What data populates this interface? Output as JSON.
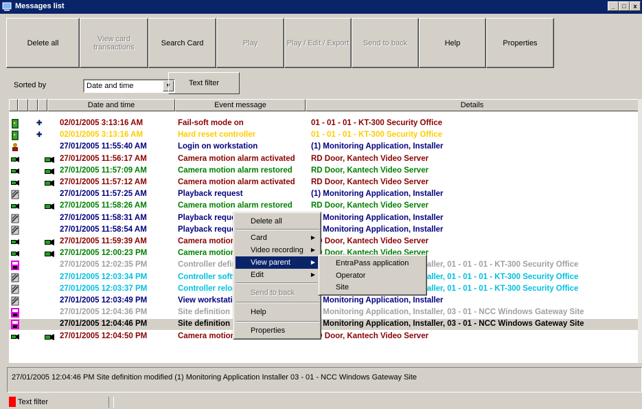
{
  "window": {
    "title": "Messages list",
    "min": "_",
    "max": "□",
    "close": "x"
  },
  "toolbar": {
    "buttons": [
      {
        "label": "Delete all",
        "enabled": true
      },
      {
        "label": "View card transactions",
        "enabled": false
      },
      {
        "label": "Search Card",
        "enabled": true
      },
      {
        "label": "Play",
        "enabled": false
      },
      {
        "label": "Play / Edit / Export",
        "enabled": false
      },
      {
        "label": "Send to back",
        "enabled": false
      },
      {
        "label": "Help",
        "enabled": true
      },
      {
        "label": "Properties",
        "enabled": true
      }
    ]
  },
  "sort": {
    "label": "Sorted by",
    "value": "Date and time",
    "text_filter": "Text filter"
  },
  "columns": {
    "date": "Date and time",
    "event": "Event message",
    "details": "Details"
  },
  "rows": [
    {
      "icon": "door-icon",
      "mark": "+",
      "color": "#8b0000",
      "date": "02/01/2005 3:13:16 AM",
      "event": "Fail-soft mode on",
      "details": "01 - 01 - 01 - KT-300 Security Office"
    },
    {
      "icon": "door-icon",
      "mark": "+",
      "color": "#ffcc00",
      "date": "02/01/2005 3:13:16 AM",
      "event": "Hard reset controller",
      "details": "01 - 01 - 01 - KT-300 Security Office"
    },
    {
      "icon": "user-icon",
      "mark": "",
      "color": "#000080",
      "date": "27/01/2005 11:55:40 AM",
      "event": "Login on workstation",
      "details": "(1) Monitoring Application, Installer"
    },
    {
      "icon": "camera-icon",
      "mark": "cam",
      "color": "#8b0000",
      "date": "27/01/2005 11:56:17 AM",
      "event": "Camera motion alarm activated",
      "details": "RD Door, Kantech Video Server"
    },
    {
      "icon": "camera-icon",
      "mark": "cam",
      "color": "#008000",
      "date": "27/01/2005 11:57:09 AM",
      "event": "Camera motion alarm restored",
      "details": "RD Door, Kantech Video Server"
    },
    {
      "icon": "camera-icon",
      "mark": "cam",
      "color": "#8b0000",
      "date": "27/01/2005 11:57:12 AM",
      "event": "Camera motion alarm activated",
      "details": "RD Door, Kantech Video Server"
    },
    {
      "icon": "playback-icon",
      "mark": "",
      "color": "#000080",
      "date": "27/01/2005 11:57:25 AM",
      "event": "Playback request",
      "details": "(1) Monitoring Application, Installer"
    },
    {
      "icon": "camera-icon",
      "mark": "cam",
      "color": "#008000",
      "date": "27/01/2005 11:58:26 AM",
      "event": "Camera motion alarm restored",
      "details": "RD Door, Kantech Video Server"
    },
    {
      "icon": "playback-icon",
      "mark": "",
      "color": "#000080",
      "date": "27/01/2005 11:58:31 AM",
      "event": "Playback request",
      "details": "(1) Monitoring Application, Installer"
    },
    {
      "icon": "playback-icon",
      "mark": "",
      "color": "#000080",
      "date": "27/01/2005 11:58:54 AM",
      "event": "Playback request",
      "details": "(1) Monitoring Application, Installer"
    },
    {
      "icon": "camera-icon",
      "mark": "cam",
      "color": "#8b0000",
      "date": "27/01/2005 11:59:39 AM",
      "event": "Camera motion alarm activated",
      "details": "RD Door, Kantech Video Server"
    },
    {
      "icon": "camera-icon",
      "mark": "cam",
      "color": "#008000",
      "date": "27/01/2005 12:00:23 PM",
      "event": "Camera motion alarm restored",
      "details": "RD Door, Kantech Video Server"
    },
    {
      "icon": "controller-icon",
      "mark": "",
      "color": "#a0a0a0",
      "date": "27/01/2005 12:02:35 PM",
      "event": "Controller definition modified",
      "details": "(1) Monitoring Application, Installer, 01 - 01 - 01 - KT-300 Security Office"
    },
    {
      "icon": "playback-icon",
      "mark": "",
      "color": "#00c0e0",
      "date": "27/01/2005 12:03:34 PM",
      "event": "Controller software reset",
      "details": "(1) Monitoring Application, Installer, 01 - 01 - 01 - KT-300 Security Office"
    },
    {
      "icon": "playback-icon",
      "mark": "",
      "color": "#00c0e0",
      "date": "27/01/2005 12:03:37 PM",
      "event": "Controller reloaded",
      "details": "(1) Monitoring Application, Installer, 01 - 01 - 01 - KT-300 Security Office"
    },
    {
      "icon": "playback-icon",
      "mark": "",
      "color": "#000080",
      "date": "27/01/2005 12:03:49 PM",
      "event": "View workstation",
      "details": "(1) Monitoring Application, Installer"
    },
    {
      "icon": "controller-icon",
      "mark": "",
      "color": "#a0a0a0",
      "date": "27/01/2005 12:04:36 PM",
      "event": "Site definition modified",
      "details": "(1) Monitoring Application, Installer, 03 - 01 - NCC Windows Gateway Site"
    },
    {
      "icon": "controller-icon",
      "mark": "",
      "color": "#000000",
      "date": "27/01/2005 12:04:46 PM",
      "event": "Site definition modified",
      "details": "(1) Monitoring Application, Installer, 03 - 01 - NCC Windows Gateway Site",
      "selected": true
    },
    {
      "icon": "camera-icon",
      "mark": "cam",
      "color": "#8b0000",
      "date": "27/01/2005 12:04:50 PM",
      "event": "Camera motion alarm activated",
      "details": "RD Door, Kantech Video Server"
    }
  ],
  "status_text": "27/01/2005 12:04:46 PM  Site definition modified  (1)  Monitoring Application  Installer  03 - 01 - NCC Windows Gateway Site",
  "bottom": {
    "label": "Text filter"
  },
  "context_menu": {
    "items": [
      {
        "label": "Delete all",
        "submenu": false
      },
      {
        "label": "Card",
        "submenu": true
      },
      {
        "label": "Video recording",
        "submenu": true
      },
      {
        "label": "View parent",
        "submenu": true,
        "active": true
      },
      {
        "label": "Edit",
        "submenu": true
      },
      {
        "label": "Send to back",
        "submenu": false,
        "disabled": true
      },
      {
        "label": "Help",
        "submenu": false
      },
      {
        "label": "Properties",
        "submenu": false
      }
    ]
  },
  "submenu": {
    "items": [
      "EntraPass application",
      "Operator",
      "Site"
    ]
  }
}
